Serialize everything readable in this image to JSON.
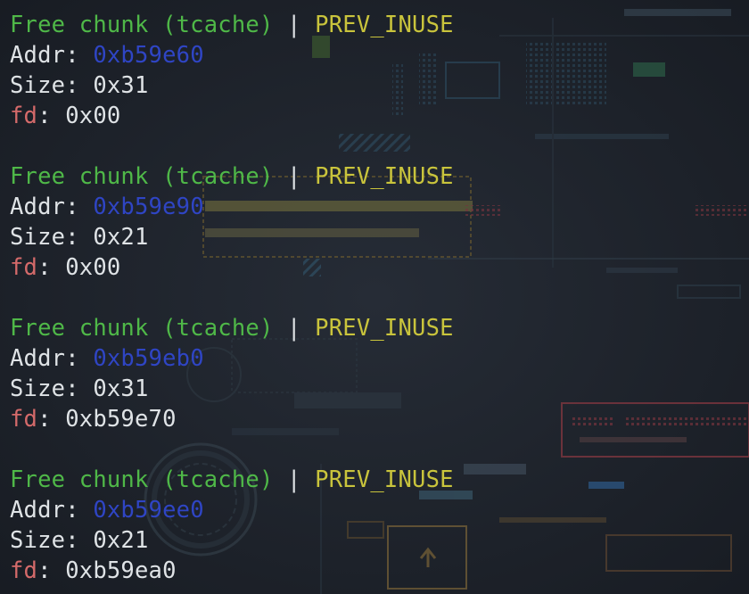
{
  "terminal": {
    "chunks": [
      {
        "header_free": "Free chunk (tcache)",
        "header_sep": " | ",
        "header_flag": "PREV_INUSE",
        "addr_label": "Addr: ",
        "addr_value": "0xb59e60",
        "size_label": "Size: ",
        "size_value": "0x31",
        "fd_label": "fd",
        "fd_sep": ": ",
        "fd_value": "0x00"
      },
      {
        "header_free": "Free chunk (tcache)",
        "header_sep": " | ",
        "header_flag": "PREV_INUSE",
        "addr_label": "Addr: ",
        "addr_value": "0xb59e90",
        "size_label": "Size: ",
        "size_value": "0x21",
        "fd_label": "fd",
        "fd_sep": ": ",
        "fd_value": "0x00"
      },
      {
        "header_free": "Free chunk (tcache)",
        "header_sep": " | ",
        "header_flag": "PREV_INUSE",
        "addr_label": "Addr: ",
        "addr_value": "0xb59eb0",
        "size_label": "Size: ",
        "size_value": "0x31",
        "fd_label": "fd",
        "fd_sep": ": ",
        "fd_value": "0xb59e70"
      },
      {
        "header_free": "Free chunk (tcache)",
        "header_sep": " | ",
        "header_flag": "PREV_INUSE",
        "addr_label": "Addr: ",
        "addr_value": "0xb59ee0",
        "size_label": "Size: ",
        "size_value": "0x21",
        "fd_label": "fd",
        "fd_sep": ": ",
        "fd_value": "0xb59ea0"
      }
    ]
  },
  "colors": {
    "background": "#1c2129",
    "free_label": "#4fb848",
    "flag_label": "#c9c43c",
    "address": "#2f45c4",
    "fd_label": "#d46a6a",
    "default_text": "#dfe3e6"
  }
}
